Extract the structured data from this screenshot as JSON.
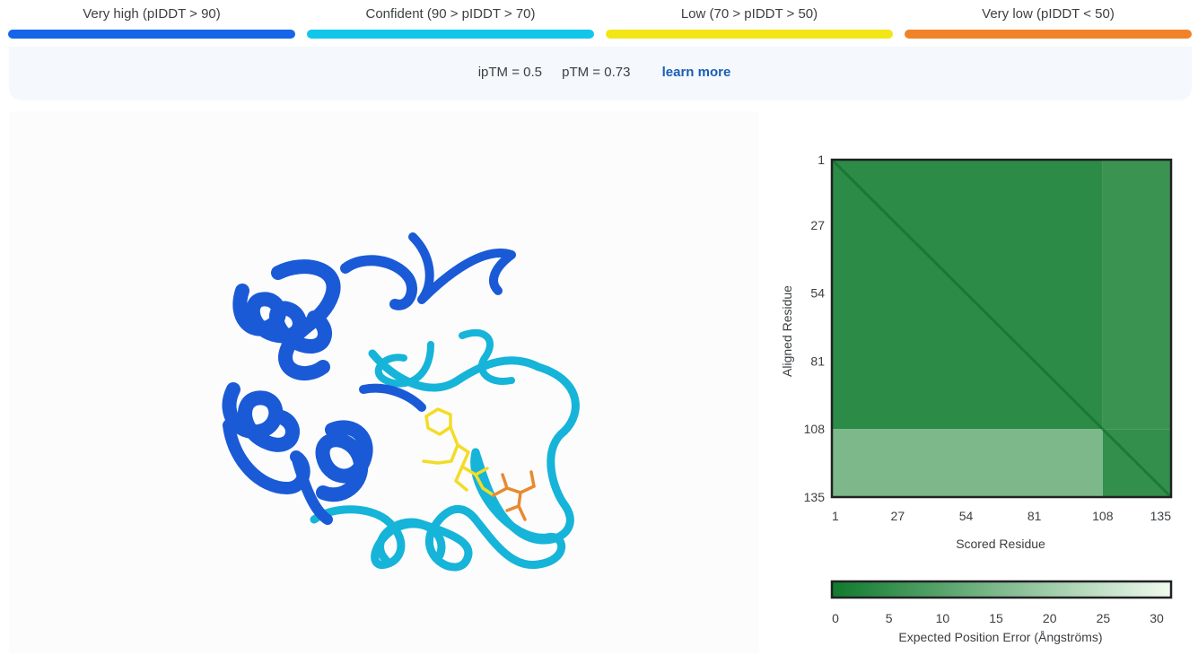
{
  "legend": [
    {
      "label": "Very high (pIDDT > 90)",
      "color": "#1565e8"
    },
    {
      "label": "Confident (90 > pIDDT > 70)",
      "color": "#12c6ea"
    },
    {
      "label": "Low (70 > pIDDT > 50)",
      "color": "#f3e617"
    },
    {
      "label": "Very low (pIDDT < 50)",
      "color": "#f0832a"
    }
  ],
  "metrics": {
    "iptm": "ipTM = 0.5",
    "ptm": "pTM = 0.73",
    "learn_more": "learn more"
  },
  "structure": {
    "helix_color": "#1a5ad6",
    "loop_color": "#16b4d8",
    "ligand_color": "#f3dc26",
    "phosphate_color": "#e88a30"
  },
  "chart_data": [
    {
      "type": "heatmap",
      "xlabel": "Scored Residue",
      "ylabel": "Aligned Residue",
      "x_ticks": [
        "1",
        "27",
        "54",
        "81",
        "108",
        "135"
      ],
      "y_ticks": [
        "1",
        "27",
        "54",
        "81",
        "108",
        "135"
      ],
      "range": [
        1,
        135
      ],
      "chain_break": 108,
      "colorscale": [
        "#0f7a2d",
        "#f0faee"
      ],
      "pae_range": [
        0,
        31
      ],
      "pae_blocks": [
        {
          "rows": [
            1,
            108
          ],
          "cols": [
            1,
            108
          ],
          "pae": 4
        },
        {
          "rows": [
            1,
            108
          ],
          "cols": [
            108,
            135
          ],
          "pae": 6
        },
        {
          "rows": [
            108,
            135
          ],
          "cols": [
            1,
            108
          ],
          "pae": 15
        },
        {
          "rows": [
            108,
            135
          ],
          "cols": [
            108,
            135
          ],
          "pae": 5
        }
      ]
    },
    {
      "type": "colorbar",
      "label": "Expected Position Error (Ångströms)",
      "ticks": [
        "0",
        "5",
        "10",
        "15",
        "20",
        "25",
        "30"
      ],
      "tick_values": [
        0,
        5,
        10,
        15,
        20,
        25,
        30
      ],
      "range": [
        0,
        31
      ],
      "colors": [
        "#0f7a2d",
        "#f0faee"
      ]
    }
  ]
}
